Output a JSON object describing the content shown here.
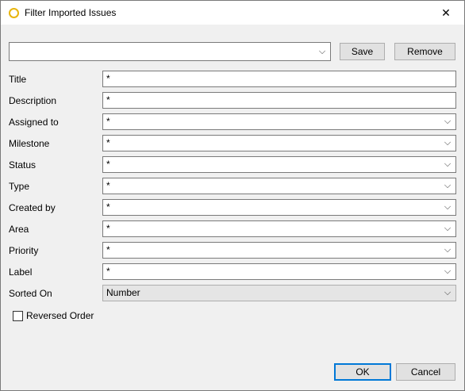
{
  "window": {
    "title": "Filter Imported Issues",
    "close_glyph": "✕"
  },
  "preset": {
    "value": "",
    "save_label": "Save",
    "remove_label": "Remove"
  },
  "fields": {
    "title": {
      "label": "Title",
      "value": "*"
    },
    "description": {
      "label": "Description",
      "value": "*"
    },
    "assigned_to": {
      "label": "Assigned to",
      "value": "*"
    },
    "milestone": {
      "label": "Milestone",
      "value": "*"
    },
    "status": {
      "label": "Status",
      "value": "*"
    },
    "type": {
      "label": "Type",
      "value": "*"
    },
    "created_by": {
      "label": "Created by",
      "value": "*"
    },
    "area": {
      "label": "Area",
      "value": "*"
    },
    "priority": {
      "label": "Priority",
      "value": "*"
    },
    "label": {
      "label": "Label",
      "value": "*"
    },
    "sorted_on": {
      "label": "Sorted On",
      "value": "Number"
    }
  },
  "reversed_order": {
    "label": "Reversed Order",
    "checked": false
  },
  "footer": {
    "ok_label": "OK",
    "cancel_label": "Cancel"
  },
  "icons": {
    "app": "app-ring-icon",
    "close": "close-icon",
    "dropdown": "chevron-down-icon",
    "chevron_glyph": "⌵"
  },
  "colors": {
    "app_icon": "#e8b50c",
    "default_button_border": "#0078d7"
  }
}
